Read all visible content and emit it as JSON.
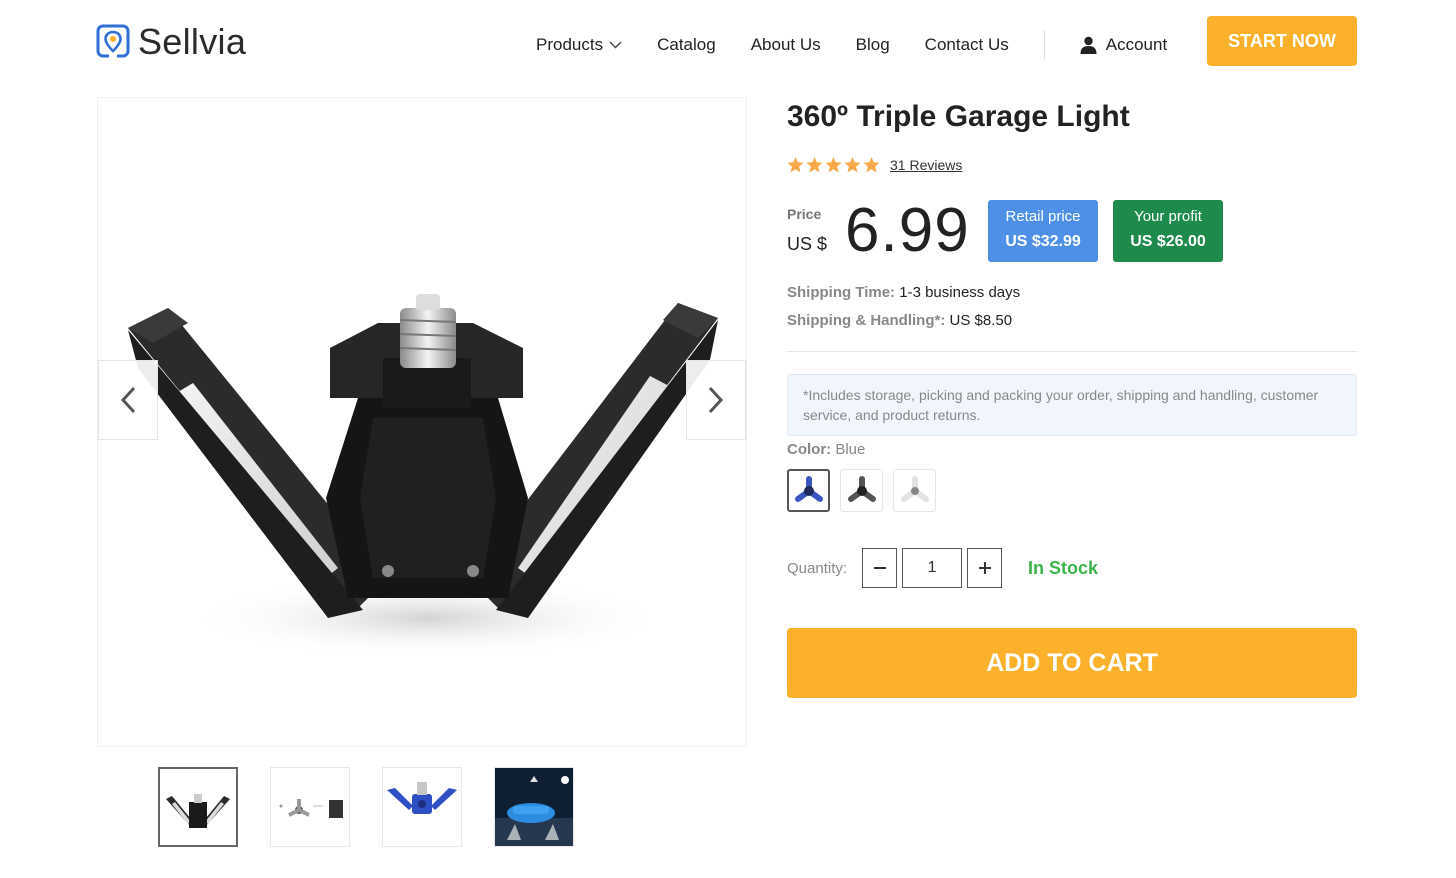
{
  "header": {
    "logo_text": "Sellvia",
    "nav": [
      {
        "label": "Products"
      },
      {
        "label": "Catalog"
      },
      {
        "label": "About Us"
      },
      {
        "label": "Blog"
      },
      {
        "label": "Contact Us"
      }
    ],
    "account_label": "Account",
    "cta_label": "START NOW"
  },
  "product": {
    "title": "360º Triple Garage Light",
    "rating": 5,
    "reviews_label": "31 Reviews",
    "price_label": "Price",
    "currency": "US $",
    "price": "6.99",
    "retail": {
      "label": "Retail price",
      "amount": "US $32.99"
    },
    "profit": {
      "label": "Your profit",
      "amount": "US $26.00"
    },
    "shipping_time": {
      "key": "Shipping Time:",
      "value": "1-3 business days"
    },
    "shipping_handling": {
      "key": "Shipping & Handling*:",
      "value": "US $8.50"
    },
    "notice": "*Includes storage, picking and packing your order, shipping and handling, customer service, and product returns.",
    "color": {
      "key": "Color:",
      "value": "Blue"
    },
    "quantity_label": "Quantity:",
    "quantity": "1",
    "stock": "In Stock",
    "cart_label": "ADD TO CART"
  },
  "colors": {
    "accent": "#fbb12b",
    "retail_badge": "#4e90e8",
    "profit_badge": "#1e8a4c",
    "stock": "#3db34c",
    "logo": "#2f6fd6"
  },
  "icons": {
    "logo": "location-pin-icon",
    "dropdown": "chevron-down-icon",
    "account": "user-icon",
    "prev": "chevron-left-icon",
    "next": "chevron-right-icon",
    "minus": "minus-icon",
    "plus": "plus-icon",
    "star": "star-icon"
  }
}
